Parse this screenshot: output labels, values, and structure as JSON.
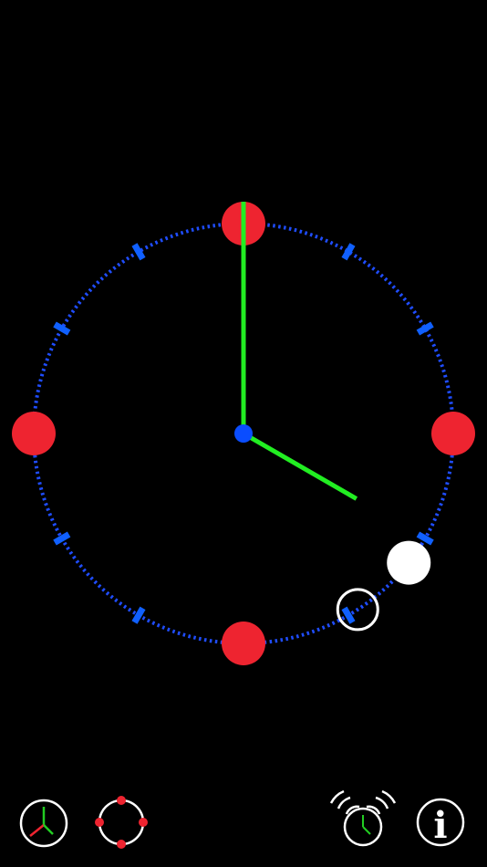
{
  "clock": {
    "hour": 4,
    "minute": 0,
    "face_color": "#1f4dff",
    "hour_marker_color": "#ee2430",
    "hand_color": "#22ee22",
    "center_color": "#0a4dff",
    "tick_color": "#1060ff",
    "alarm_marker_color": "#ffffff"
  },
  "alarm": {
    "set_marker_hour": 4,
    "set_marker_minute": 0,
    "outline_marker_hour": 5,
    "outline_marker_minute": 0
  },
  "toolbar": {
    "hands_icon": "clock-hands-icon",
    "dots_icon": "hour-dots-icon",
    "alarm_icon": "alarm-clock-icon",
    "info_icon": "info-icon",
    "info_glyph": "i"
  }
}
